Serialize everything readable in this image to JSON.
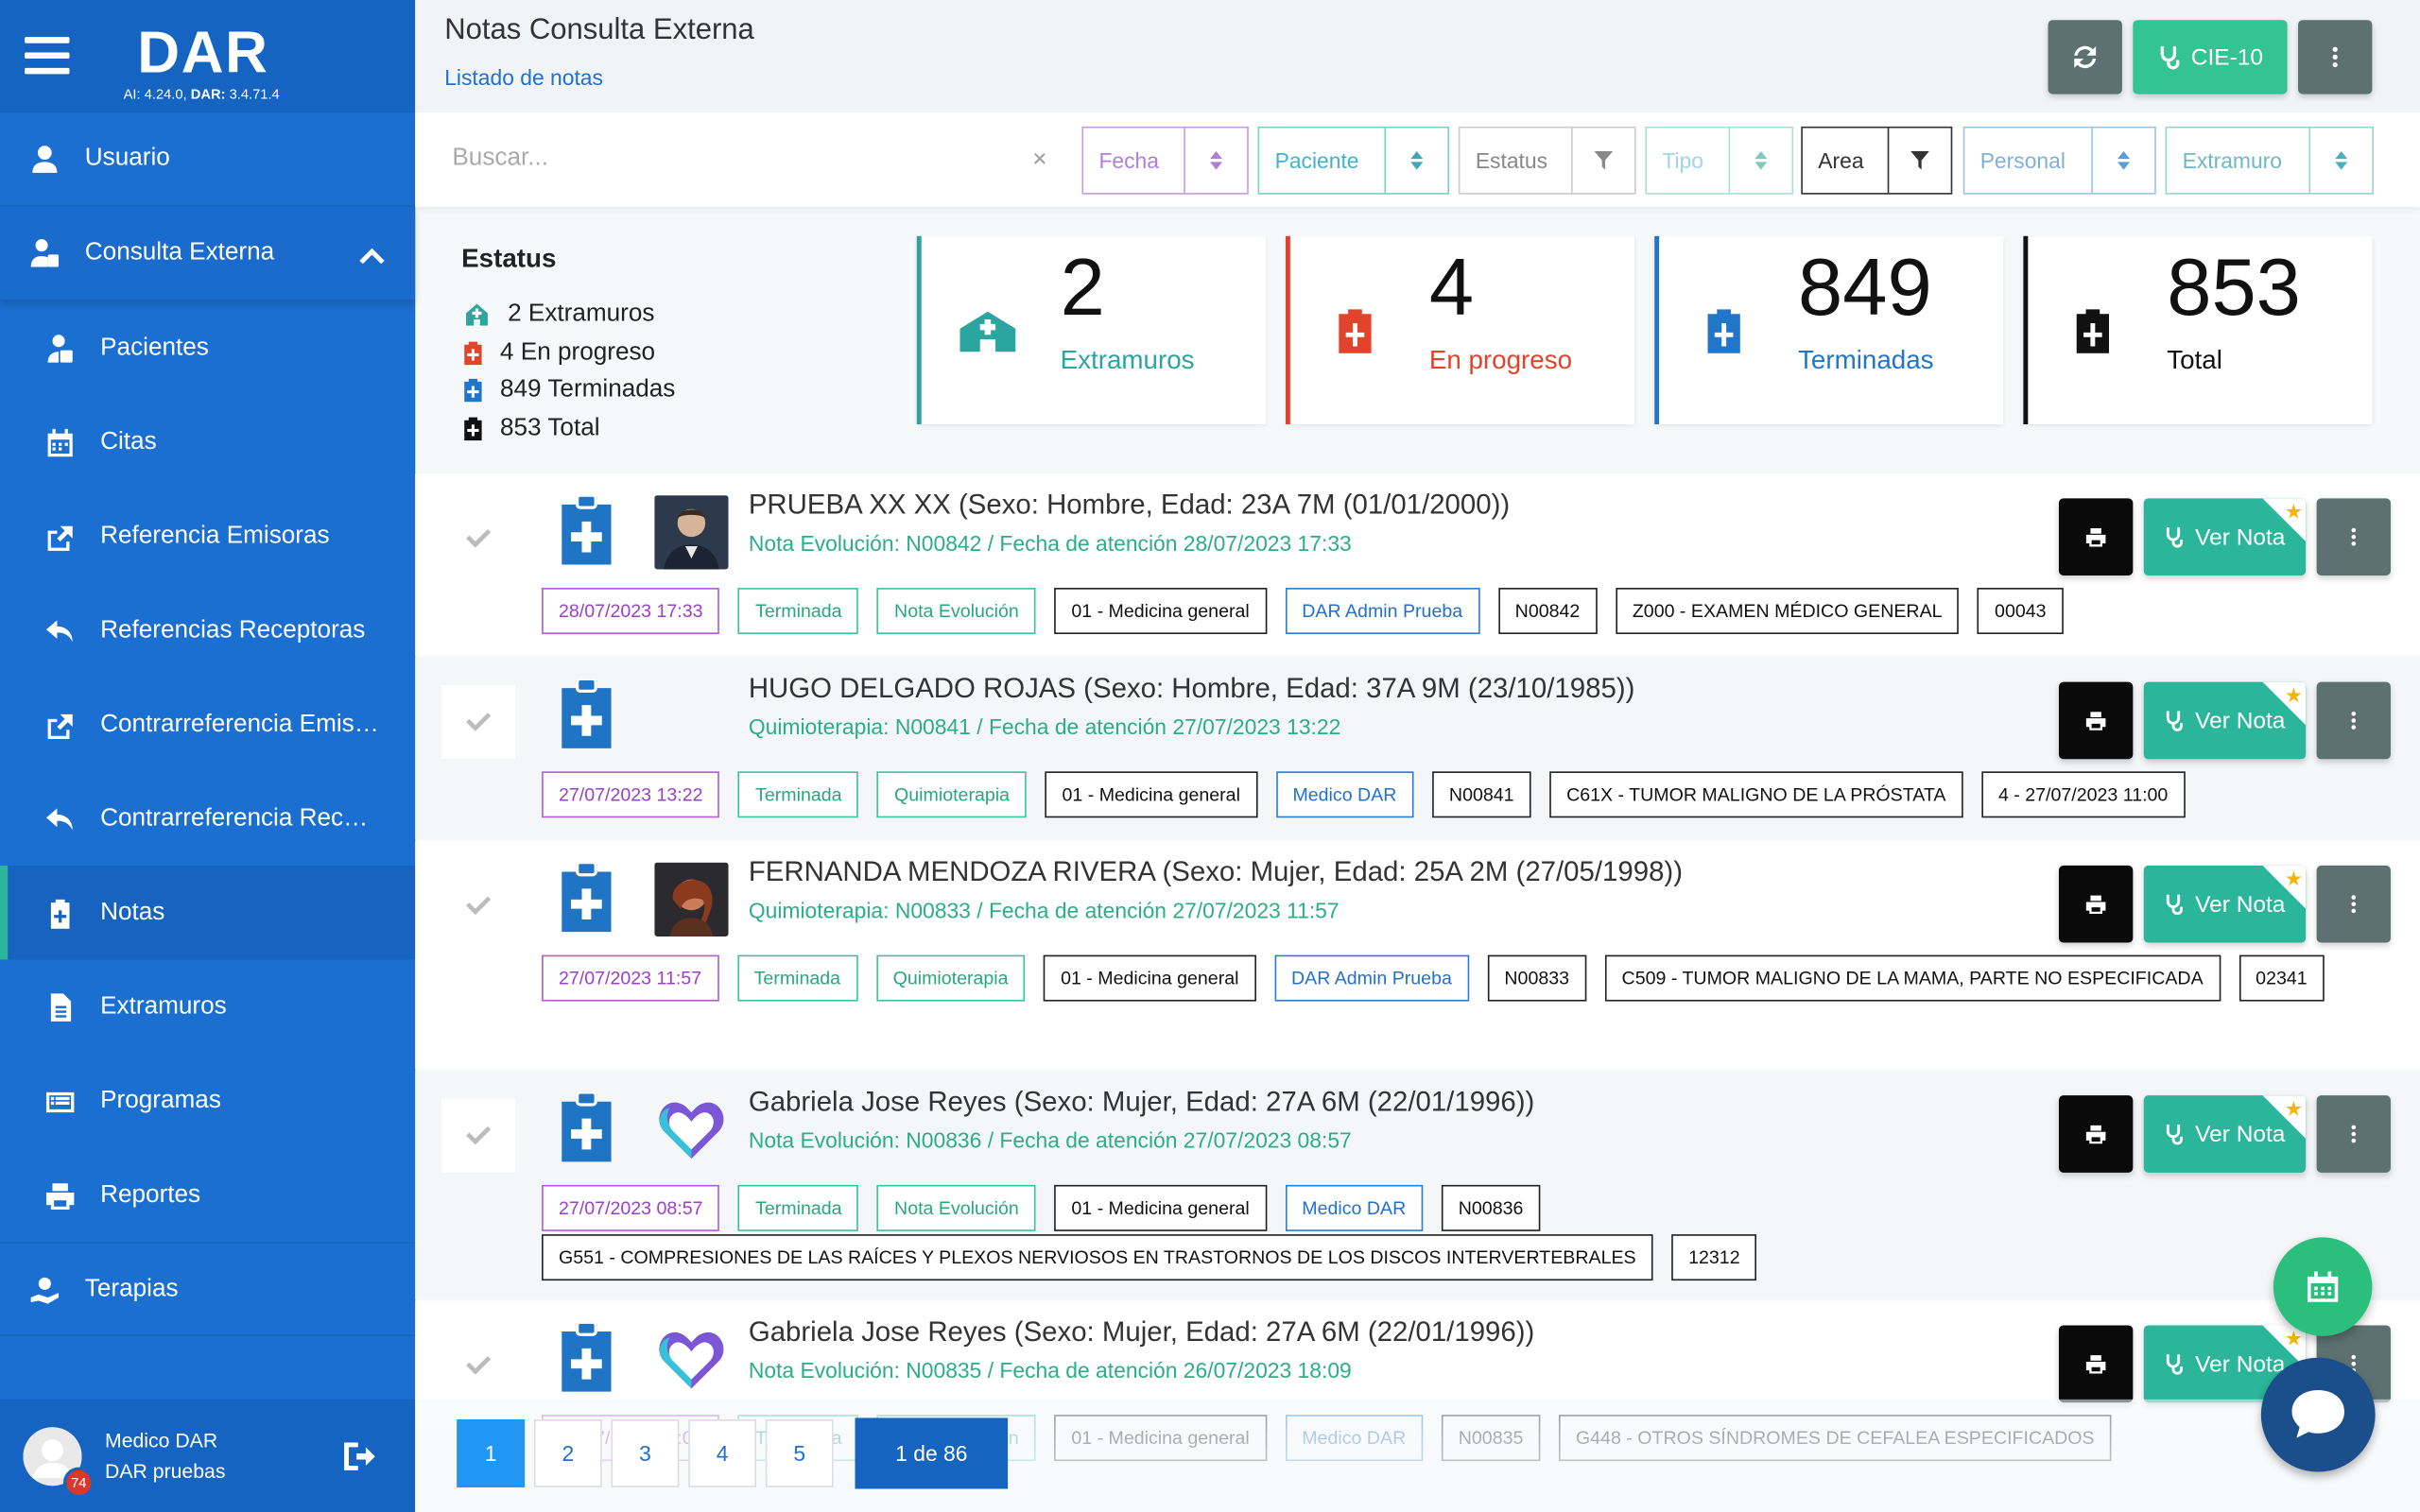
{
  "app": {
    "logo": "DAR",
    "version_ai_label": "AI:",
    "version_ai": "4.24.0,",
    "version_dar_label": "DAR:",
    "version_dar": "3.4.71.4"
  },
  "sidebar": {
    "top": [
      {
        "label": "Usuario",
        "icon": "user-icon"
      },
      {
        "label": "Consulta Externa",
        "icon": "user-clipboard-icon"
      }
    ],
    "items": [
      {
        "label": "Pacientes",
        "icon": "patient-icon"
      },
      {
        "label": "Citas",
        "icon": "calendar-icon"
      },
      {
        "label": "Referencia Emisoras",
        "icon": "share-out-icon"
      },
      {
        "label": "Referencias Receptoras",
        "icon": "reply-icon"
      },
      {
        "label": "Contrarreferencia Emis…",
        "icon": "share-out-icon"
      },
      {
        "label": "Contrarreferencia Rec…",
        "icon": "reply-icon"
      },
      {
        "label": "Notas",
        "icon": "clipboard-plus-icon"
      },
      {
        "label": "Extramuros",
        "icon": "document-icon"
      },
      {
        "label": "Programas",
        "icon": "list-icon"
      },
      {
        "label": "Reportes",
        "icon": "printer-icon"
      }
    ],
    "bottom": {
      "label": "Terapias",
      "icon": "hand-heart-icon"
    },
    "user": {
      "name": "Medico DAR",
      "org": "DAR pruebas",
      "badge": "74"
    }
  },
  "header": {
    "title": "Notas Consulta Externa",
    "breadcrumb": "Listado de notas",
    "cie_label": "CIE-10",
    "colors": {
      "refresh": "#5d7270",
      "cie": "#34c393",
      "more": "#5d7270"
    }
  },
  "filters": {
    "search_placeholder": "Buscar...",
    "clear": "×",
    "items": [
      "Fecha",
      "Paciente",
      "Estatus",
      "Tipo",
      "Area",
      "Personal",
      "Extramuro"
    ]
  },
  "status": {
    "title": "Estatus",
    "lines": [
      "2 Extramuros",
      "4 En progreso",
      "849 Terminadas",
      "853 Total"
    ]
  },
  "cards": [
    {
      "value": "2",
      "label": "Extramuros",
      "color": "#2aa5a0"
    },
    {
      "value": "4",
      "label": "En progreso",
      "color": "#e0452c"
    },
    {
      "value": "849",
      "label": "Terminadas",
      "color": "#2276c9"
    },
    {
      "value": "853",
      "label": "Total",
      "color": "#111111"
    }
  ],
  "notes": [
    {
      "name": "PRUEBA XX XX (Sexo: Hombre, Edad: 23A 7M (01/01/2000))",
      "note": "Nota Evolución: N00842 / Fecha de atención 28/07/2023 17:33",
      "photo": "man",
      "tags": [
        "28/07/2023 17:33",
        "Terminada",
        "Nota Evolución",
        "01 - Medicina general",
        "DAR Admin Prueba",
        "N00842",
        "Z000 - EXAMEN MÉDICO GENERAL",
        "00043"
      ]
    },
    {
      "name": "HUGO DELGADO ROJAS (Sexo: Hombre, Edad: 37A 9M (23/10/1985))",
      "note": "Quimioterapia: N00841 / Fecha de atención 27/07/2023 13:22",
      "photo": "none",
      "tags": [
        "27/07/2023 13:22",
        "Terminada",
        "Quimioterapia",
        "01 - Medicina general",
        "Medico DAR",
        "N00841",
        "C61X - TUMOR MALIGNO DE LA PRÓSTATA",
        "4 - 27/07/2023 11:00"
      ]
    },
    {
      "name": "FERNANDA MENDOZA RIVERA (Sexo: Mujer, Edad: 25A 2M (27/05/1998))",
      "note": "Quimioterapia: N00833 / Fecha de atención 27/07/2023 11:57",
      "photo": "woman",
      "tags": [
        "27/07/2023 11:57",
        "Terminada",
        "Quimioterapia",
        "01 - Medicina general",
        "DAR Admin Prueba",
        "N00833",
        "C509 - TUMOR MALIGNO DE LA MAMA, PARTE NO ESPECIFICADA",
        "02341"
      ]
    },
    {
      "name": "Gabriela Jose Reyes (Sexo: Mujer, Edad: 27A 6M (22/01/1996))",
      "note": "Nota Evolución: N00836 / Fecha de atención 27/07/2023 08:57",
      "photo": "heart",
      "tags": [
        "27/07/2023 08:57",
        "Terminada",
        "Nota Evolución",
        "01 - Medicina general",
        "Medico DAR",
        "N00836",
        "G551 - COMPRESIONES DE LAS RAÍCES Y PLEXOS NERVIOSOS EN TRASTORNOS DE LOS DISCOS INTERVERTEBRALES",
        "12312"
      ]
    },
    {
      "name": "Gabriela Jose Reyes (Sexo: Mujer, Edad: 27A 6M (22/01/1996))",
      "note": "Nota Evolución: N00835 / Fecha de atención 26/07/2023 18:09",
      "photo": "heart",
      "tags": [
        "26/07/2023 18:09",
        "Terminada",
        "Nota Evolución",
        "01 - Medicina general",
        "Medico DAR",
        "N00835",
        "G448 - OTROS SÍNDROMES DE CEFALEA ESPECIFICADOS",
        ""
      ]
    }
  ],
  "actions": {
    "view_label": "Ver Nota"
  },
  "pager": {
    "pages": [
      "1",
      "2",
      "3",
      "4",
      "5"
    ],
    "count": "1 de 86"
  }
}
